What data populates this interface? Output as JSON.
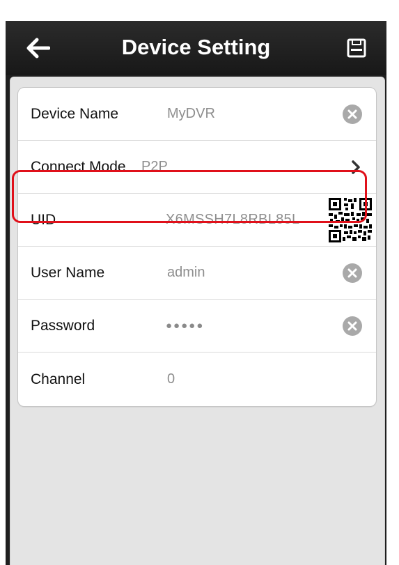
{
  "navbar": {
    "title": "Device Setting",
    "back_icon": "arrow-left-icon",
    "save_icon": "floppy-disk-icon"
  },
  "form": {
    "device_name": {
      "label": "Device Name",
      "value": "MyDVR"
    },
    "connect_mode": {
      "label": "Connect Mode",
      "value": "P2P"
    },
    "uid": {
      "label": "UID",
      "value": "X6MSSH7L8RBL85L"
    },
    "user_name": {
      "label": "User Name",
      "value": "admin"
    },
    "password": {
      "label": "Password",
      "value": "●●●●●"
    },
    "channel": {
      "label": "Channel",
      "value": "0"
    }
  },
  "colors": {
    "navbar": "#1f1f1f",
    "highlight": "#e0101a",
    "background": "#e4e4e4"
  }
}
